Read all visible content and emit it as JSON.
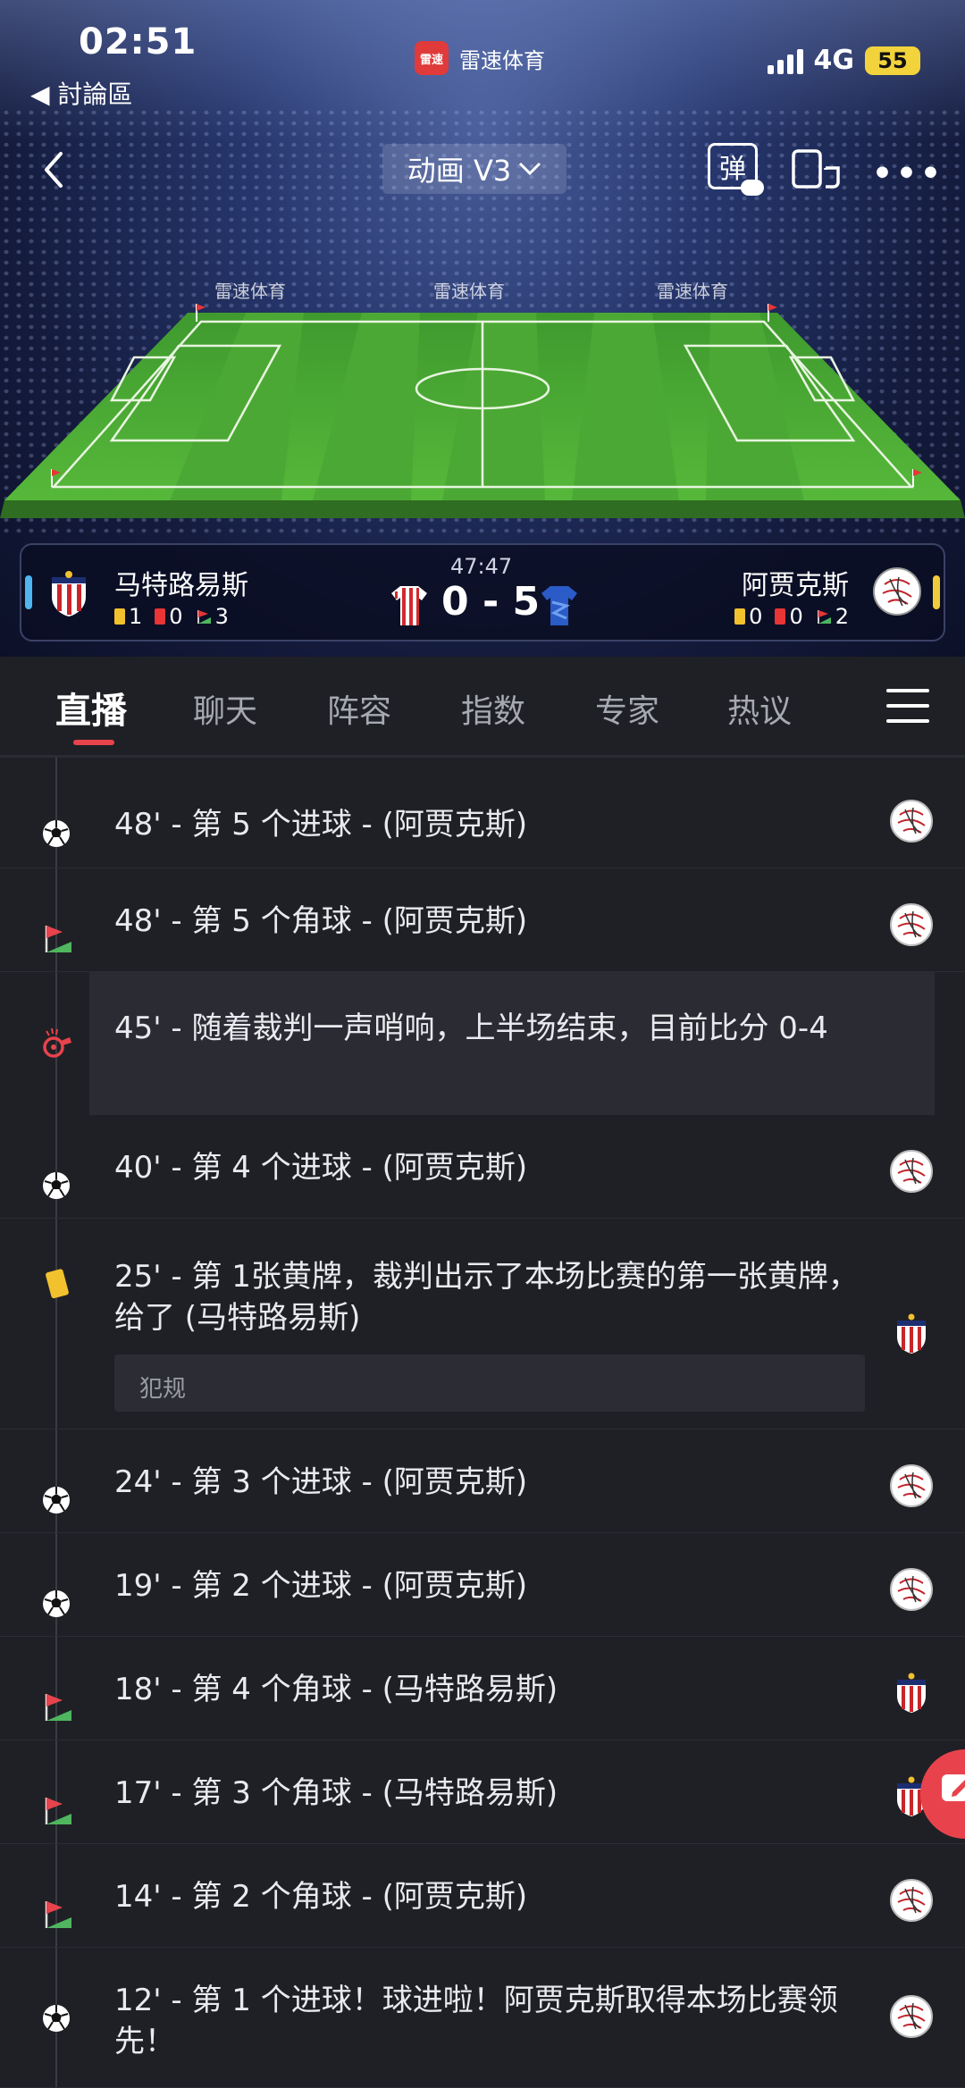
{
  "status": {
    "time": "02:51",
    "back_app": "◀ 討論區",
    "app_name": "雷速体育",
    "app_icon_text": "雷速",
    "network": "4G",
    "battery": "55"
  },
  "nav": {
    "title": "动画 V3",
    "danmu_label": "弹"
  },
  "match": {
    "time": "47:47",
    "home": {
      "name": "马特路易斯",
      "yellow": "1",
      "red": "0",
      "corners": "3",
      "color": "#4fb5ef"
    },
    "away": {
      "name": "阿贾克斯",
      "yellow": "0",
      "red": "0",
      "corners": "2",
      "color": "#f2cb3c"
    },
    "home_score": "0",
    "away_score": "5",
    "separator": "-"
  },
  "tabs": [
    "直播",
    "聊天",
    "阵容",
    "指数",
    "专家",
    "热议"
  ],
  "events": [
    {
      "icon": "goal-icon",
      "text": "48' - 第 5 个进球 - (阿贾克斯)",
      "team": "away"
    },
    {
      "icon": "corner-icon",
      "text": "48' - 第 5 个角球 - (阿贾克斯)",
      "team": "away"
    },
    {
      "icon": "whistle-icon",
      "text": "45' - 随着裁判一声哨响，上半场结束，目前比分 0-4",
      "team": ""
    },
    {
      "icon": "goal-icon",
      "text": "40' - 第 4 个进球 - (阿贾克斯)",
      "team": "away"
    },
    {
      "icon": "yellow-card-icon",
      "text": "25' - 第 1张黄牌，裁判出示了本场比赛的第一张黄牌，给了 (马特路易斯)",
      "team": "home",
      "note": "犯规"
    },
    {
      "icon": "goal-icon",
      "text": "24' - 第 3 个进球 - (阿贾克斯)",
      "team": "away"
    },
    {
      "icon": "goal-icon",
      "text": "19' - 第 2 个进球 - (阿贾克斯)",
      "team": "away"
    },
    {
      "icon": "corner-icon",
      "text": "18' - 第 4 个角球 - (马特路易斯)",
      "team": "home"
    },
    {
      "icon": "corner-icon",
      "text": "17' - 第 3 个角球 - (马特路易斯)",
      "team": "home"
    },
    {
      "icon": "corner-icon",
      "text": "14' - 第 2 个角球 - (阿贾克斯)",
      "team": "away"
    },
    {
      "icon": "goal-icon",
      "text": "12' - 第 1 个进球！球进啦！阿贾克斯取得本场比赛领先！",
      "team": "away"
    }
  ],
  "colors": {
    "accent": "#e8434c",
    "background": "#1f2025"
  }
}
